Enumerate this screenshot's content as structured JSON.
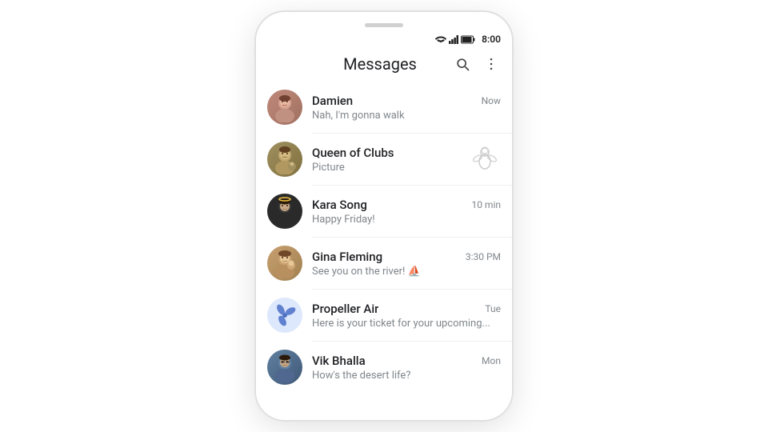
{
  "phone": {
    "status_bar": {
      "time": "8:00"
    },
    "app_bar": {
      "title": "Messages",
      "search_label": "search",
      "more_label": "more options"
    },
    "conversations": [
      {
        "id": "damien",
        "name": "Damien",
        "preview": "Nah, I'm gonna walk",
        "time": "Now",
        "avatar_emoji": "🧑",
        "avatar_bg": "#b07060",
        "has_thumbnail": false
      },
      {
        "id": "queen-of-clubs",
        "name": "Queen of Clubs",
        "preview": "Picture",
        "time": "",
        "avatar_emoji": "👥",
        "avatar_bg": "#907850",
        "has_thumbnail": true,
        "thumbnail_emoji": "🐉"
      },
      {
        "id": "kara-song",
        "name": "Kara Song",
        "preview": "Happy Friday!",
        "time": "10 min",
        "avatar_emoji": "👤",
        "avatar_bg": "#303030",
        "has_thumbnail": false
      },
      {
        "id": "gina-fleming",
        "name": "Gina Fleming",
        "preview": "See you on the river! ⛵",
        "time": "3:30 PM",
        "avatar_emoji": "🧑",
        "avatar_bg": "#b08060",
        "has_thumbnail": false
      },
      {
        "id": "propeller-air",
        "name": "Propeller Air",
        "preview": "Here is your ticket for your upcoming...",
        "time": "Tue",
        "avatar_emoji": "✈",
        "avatar_bg": "#c8d8f8",
        "avatar_color": "#4060c0",
        "has_thumbnail": false
      },
      {
        "id": "vik-bhalla",
        "name": "Vik Bhalla",
        "preview": "How's the desert life?",
        "time": "Mon",
        "avatar_emoji": "🧑",
        "avatar_bg": "#5070a0",
        "has_thumbnail": false
      }
    ]
  }
}
